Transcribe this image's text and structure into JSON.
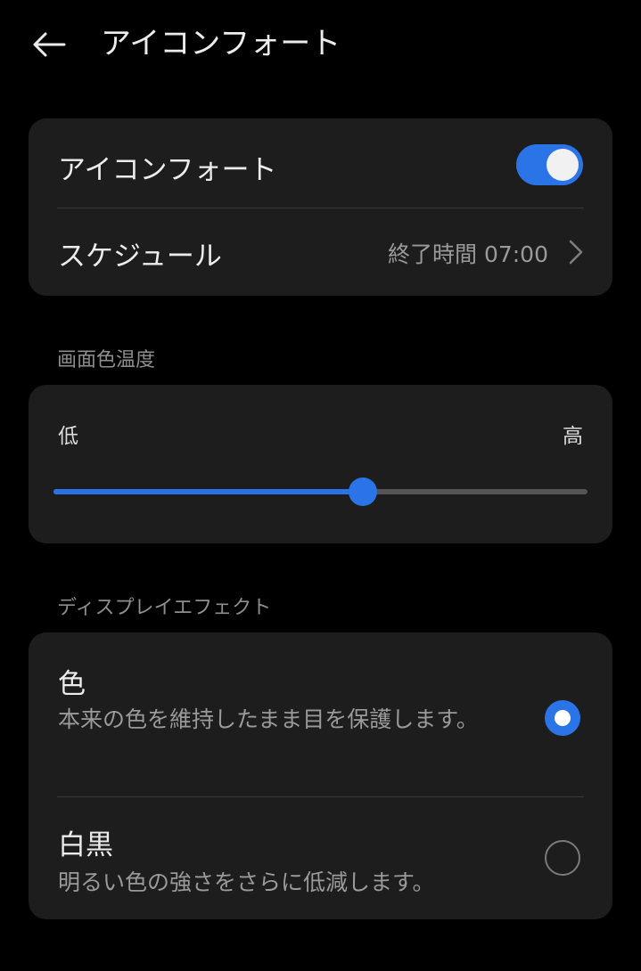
{
  "header": {
    "title": "アイコンフォート",
    "back_icon": "arrow-left-icon"
  },
  "comfort_card": {
    "toggle_label": "アイコンフォート",
    "toggle_on": true,
    "schedule_label": "スケジュール",
    "schedule_value": "終了時間 07:00",
    "chevron_icon": "chevron-right-icon"
  },
  "color_temp": {
    "section_title": "画面色温度",
    "low_label": "低",
    "high_label": "高",
    "value_fraction": 0.58
  },
  "display_effect": {
    "section_title": "ディスプレイエフェクト",
    "options": [
      {
        "title": "色",
        "description": "本来の色を維持したまま目を保護します。",
        "selected": true
      },
      {
        "title": "白黒",
        "description": "明るい色の強さをさらに低減します。",
        "selected": false
      }
    ]
  },
  "colors": {
    "accent": "#2b74e8",
    "card_background": "#1d1d1d",
    "page_background": "#000000"
  }
}
